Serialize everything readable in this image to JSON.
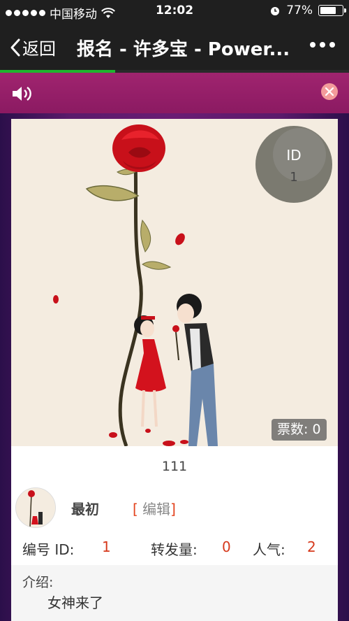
{
  "status_bar": {
    "carrier": "中国移动",
    "time": "12:02",
    "battery": "77%",
    "battery_level": 0.77
  },
  "nav": {
    "back_label": "返回",
    "title": "报名 - 许多宝 - Power..."
  },
  "page_load_progress": 0.33,
  "entry": {
    "id_label": "ID",
    "id_value": "1",
    "votes": "票数: 0",
    "title": "111",
    "author": "最初",
    "edit_bracket_open": "[",
    "edit_label": "编辑",
    "edit_bracket_close": "]",
    "stats": {
      "id_label": "编号 ID:",
      "id_value": "1",
      "shares_label": "转发量:",
      "shares_value": "0",
      "popularity_label": "人气:",
      "popularity_value": "2"
    },
    "intro_label": "介绍:",
    "intro_text": "女神来了"
  },
  "colors": {
    "nav_bg": "#1f1f1f",
    "banner_bg": "#a0246f",
    "accent_red": "#d6391c",
    "progress": "#1fb52e"
  }
}
